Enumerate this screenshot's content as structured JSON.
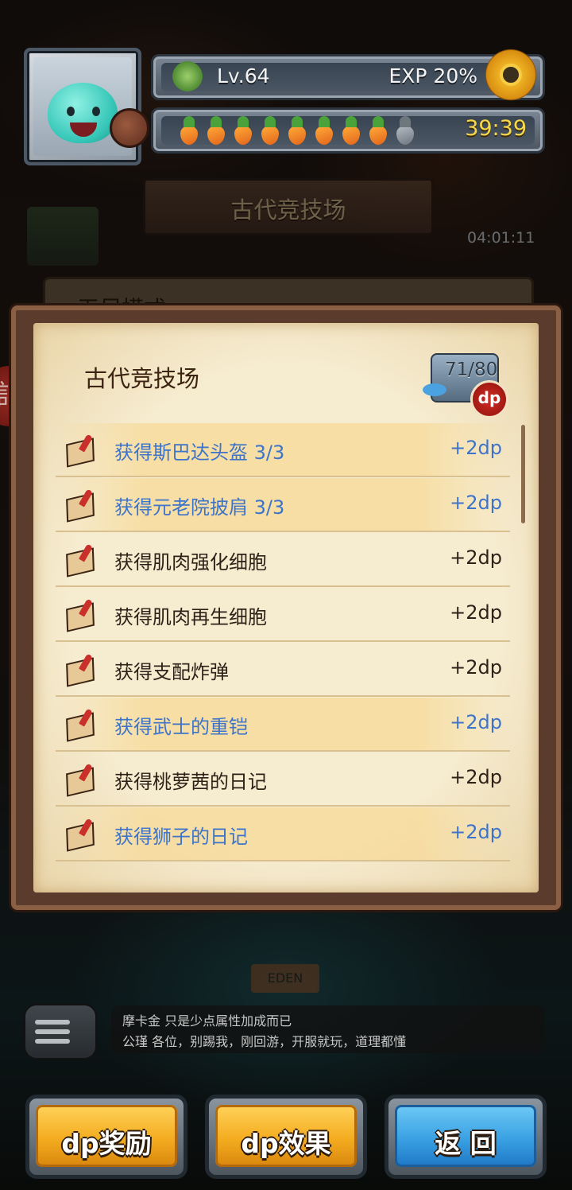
{
  "header": {
    "level": "Lv.64",
    "exp": "EXP 20%",
    "stamina_full": 8,
    "stamina_max": 9,
    "timer": "39:39"
  },
  "background": {
    "arena_title": "古代竞技场",
    "side_timer": "04:01:11",
    "mode_label": "无尽模式",
    "eden_sign": "EDEN"
  },
  "panel": {
    "title": "古代竞技场",
    "count": "71/80",
    "badge": "dp",
    "rows": [
      {
        "text": "获得斯巴达头盔 3/3",
        "dp": "+2dp",
        "highlighted": true
      },
      {
        "text": "获得元老院披肩 3/3",
        "dp": "+2dp",
        "highlighted": true
      },
      {
        "text": "获得肌肉强化细胞",
        "dp": "+2dp",
        "highlighted": false
      },
      {
        "text": "获得肌肉再生细胞",
        "dp": "+2dp",
        "highlighted": false
      },
      {
        "text": "获得支配炸弹",
        "dp": "+2dp",
        "highlighted": false
      },
      {
        "text": "获得武士的重铠",
        "dp": "+2dp",
        "highlighted": true
      },
      {
        "text": "获得桃萝茜的日记",
        "dp": "+2dp",
        "highlighted": false
      },
      {
        "text": "获得狮子的日记",
        "dp": "+2dp",
        "highlighted": true
      }
    ]
  },
  "chat": {
    "line1": "摩卡金  只是少点属性加成而已",
    "line2": "公瑾  各位，别踢我，刚回游，开服就玩，道理都懂"
  },
  "buttons": {
    "reward": "dp奖励",
    "effect": "dp效果",
    "back": "返 回"
  }
}
